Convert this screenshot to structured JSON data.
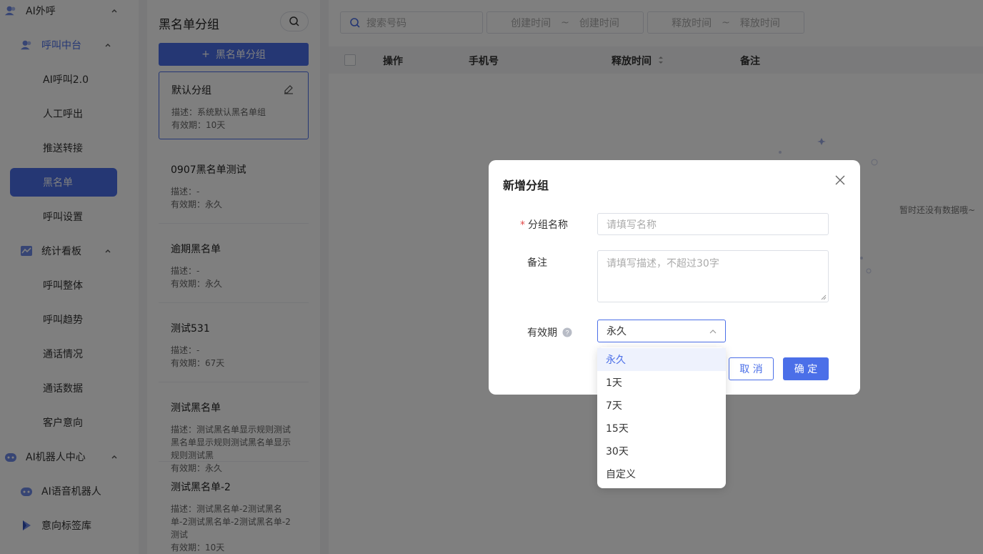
{
  "sidebar": {
    "items": [
      {
        "label": "AI外呼",
        "level": 0,
        "icon": "users-icon",
        "expanded": true
      },
      {
        "label": "呼叫中台",
        "level": 1,
        "icon": "users-icon",
        "expanded": true,
        "active": true
      },
      {
        "label": "AI呼叫2.0",
        "level": 2
      },
      {
        "label": "人工呼出",
        "level": 2
      },
      {
        "label": "推送转接",
        "level": 2
      },
      {
        "label": "黑名单",
        "level": 2,
        "selected": true
      },
      {
        "label": "呼叫设置",
        "level": 2
      },
      {
        "label": "统计看板",
        "level": 1,
        "icon": "chart-icon",
        "expanded": true
      },
      {
        "label": "呼叫整体",
        "level": 2
      },
      {
        "label": "呼叫趋势",
        "level": 2
      },
      {
        "label": "通话情况",
        "level": 2
      },
      {
        "label": "通话数据",
        "level": 2
      },
      {
        "label": "客户意向",
        "level": 2
      },
      {
        "label": "AI机器人中心",
        "level": 0,
        "icon": "robot-icon",
        "expanded": true
      },
      {
        "label": "AI语音机器人",
        "level": 1,
        "icon": "robot-icon"
      },
      {
        "label": "意向标签库",
        "level": 1,
        "icon": "tag-icon"
      }
    ]
  },
  "group_panel": {
    "title": "黑名单分组",
    "add_button": "黑名单分组",
    "groups": [
      {
        "name": "默认分组",
        "desc": "描述：系统默认黑名单组",
        "expiry": "有效期：10天",
        "selected": true
      },
      {
        "name": "0907黑名单测试",
        "desc": "描述：-",
        "expiry": "有效期：永久"
      },
      {
        "name": "逾期黑名单",
        "desc": "描述：-",
        "expiry": "有效期：永久"
      },
      {
        "name": "测试531",
        "desc": "描述：-",
        "expiry": "有效期：67天"
      },
      {
        "name": "测试黑名单",
        "desc": "描述：测试黑名单显示规则测试黑名单显示规则测试黑名单显示规则测试黑",
        "expiry": "有效期：永久"
      },
      {
        "name": "测试黑名单-2",
        "desc": "描述：测试黑名单-2测试黑名单-2测试黑名单-2测试黑名单-2测试",
        "expiry": "有效期：10天"
      }
    ]
  },
  "filters": {
    "search_placeholder": "搜索号码",
    "create_start": "创建时间",
    "create_end": "创建时间",
    "release_start": "释放时间",
    "release_end": "释放时间",
    "range_sep": "~"
  },
  "table": {
    "columns": [
      "操作",
      "手机号",
      "释放时间",
      "备注"
    ],
    "empty_text": "暂时还没有数据哦~"
  },
  "dialog": {
    "title": "新增分组",
    "name_label": "分组名称",
    "name_placeholder": "请填写名称",
    "note_label": "备注",
    "note_placeholder": "请填写描述，不超过30字",
    "expiry_label": "有效期",
    "expiry_value": "永久",
    "cancel": "取 消",
    "confirm": "确 定"
  },
  "dropdown": {
    "options": [
      "永久",
      "1天",
      "7天",
      "15天",
      "30天",
      "自定义"
    ],
    "selected": "永久"
  },
  "colors": {
    "primary": "#4b6fe8",
    "required": "#e24a4a"
  }
}
